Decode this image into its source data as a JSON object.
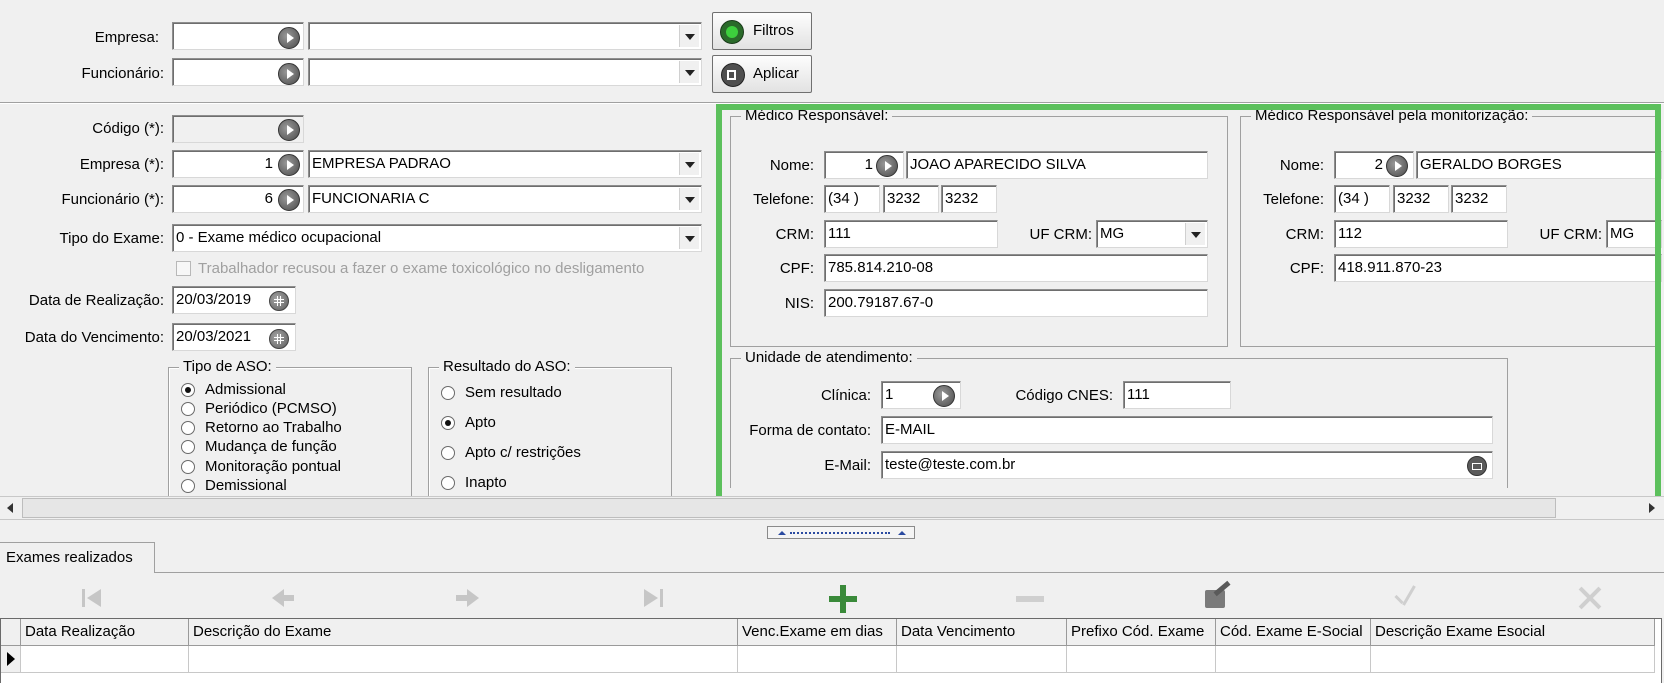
{
  "filter": {
    "empresa_label": "Empresa:",
    "funcionario_label": "Funcionário:",
    "filtros_button": "Filtros",
    "aplicar_button": "Aplicar"
  },
  "form": {
    "codigo_label": "Código (*):",
    "empresa_label": "Empresa (*):",
    "empresa_code": "1",
    "empresa_name": "EMPRESA PADRAO",
    "funcionario_label": "Funcionário (*):",
    "funcionario_code": "6",
    "funcionario_name": "FUNCIONARIA C",
    "tipo_exame_label": "Tipo do Exame:",
    "tipo_exame_value": "0 - Exame médico ocupacional",
    "recusou_label": "Trabalhador recusou a fazer o exame toxicológico no desligamento",
    "data_realizacao_label": "Data de Realização:",
    "data_realizacao_value": "20/03/2019",
    "data_vencimento_label": "Data do Vencimento:",
    "data_vencimento_value": "20/03/2021"
  },
  "tipo_aso": {
    "title": "Tipo de ASO:",
    "options": [
      "Admissional",
      "Periódico (PCMSO)",
      "Retorno ao Trabalho",
      "Mudança de função",
      "Monitoração pontual",
      "Demissional"
    ],
    "selected": "Admissional"
  },
  "resultado_aso": {
    "title": "Resultado do ASO:",
    "options": [
      "Sem resultado",
      "Apto",
      "Apto c/ restrições",
      "Inapto"
    ],
    "selected": "Apto"
  },
  "medico_resp": {
    "title": "Médico Responsável:",
    "nome_label": "Nome:",
    "code": "1",
    "nome": "JOAO APARECIDO SILVA",
    "telefone_label": "Telefone:",
    "ddd": "(34  )",
    "tel1": "3232",
    "tel2": "3232",
    "crm_label": "CRM:",
    "crm": "111",
    "uf_label": "UF CRM:",
    "uf": "MG",
    "cpf_label": "CPF:",
    "cpf": "785.814.210-08",
    "nis_label": "NIS:",
    "nis": "200.79187.67-0"
  },
  "medico_mon": {
    "title": "Médico Responsável pela monitorização:",
    "nome_label": "Nome:",
    "code": "2",
    "nome": "GERALDO BORGES",
    "telefone_label": "Telefone:",
    "ddd": "(34  )",
    "tel1": "3232",
    "tel2": "3232",
    "crm_label": "CRM:",
    "crm": "112",
    "uf_label": "UF CRM:",
    "uf": "MG",
    "cpf_label": "CPF:",
    "cpf": "418.911.870-23"
  },
  "unidade": {
    "title": "Unidade de atendimento:",
    "clinica_label": "Clínica:",
    "clinica": "1",
    "cnes_label": "Código CNES:",
    "cnes": "111",
    "contato_label": "Forma de contato:",
    "contato": "E-MAIL",
    "email_label": "E-Mail:",
    "email": "teste@teste.com.br"
  },
  "tab": {
    "label": "Exames realizados"
  },
  "grid": {
    "columns": [
      "Data Realização",
      "Descrição do Exame",
      "Venc.Exame em dias",
      "Data Vencimento",
      "Prefixo Cód. Exame",
      "Cód. Exame E-Social",
      "Descrição Exame Esocial"
    ]
  },
  "colors": {
    "highlight": "#5cc05c",
    "nav_add": "#3a8a3a"
  }
}
